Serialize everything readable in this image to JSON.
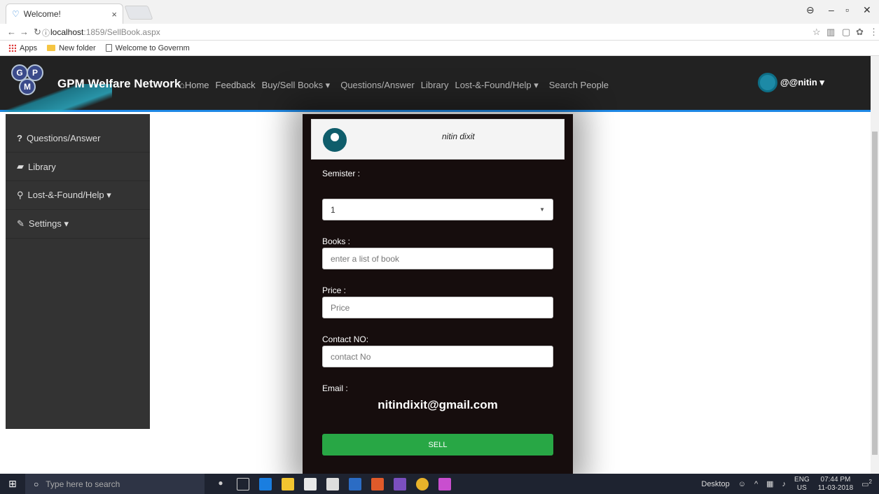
{
  "browser": {
    "tab_title": "Welcome!",
    "tab_close": "×",
    "url_host": "localhost",
    "url_path": ":1859/SellBook.aspx",
    "bookmarks": [
      "Apps",
      "New folder",
      "Welcome to Governm"
    ]
  },
  "navbar": {
    "brand": "GPM Welfare Network",
    "logo_letters": [
      "G",
      "P",
      "M"
    ],
    "links": [
      "Home",
      "Feedback",
      "Buy/Sell Books ▾",
      "Questions/Answer",
      "Library",
      "Lost-&-Found/Help ▾",
      "Search People"
    ],
    "user": "@@nitin ▾"
  },
  "sidebar": {
    "items": [
      {
        "icon": "?",
        "label": "Questions/Answer"
      },
      {
        "icon": "▰",
        "label": "Library"
      },
      {
        "icon": "⚲",
        "label": "Lost-&-Found/Help ▾"
      },
      {
        "icon": "✎",
        "label": "Settings ▾"
      }
    ]
  },
  "form": {
    "profile_name": "nitin dixit",
    "semester_label": "Semister :",
    "semester_value": "1",
    "books_label": "Books :",
    "books_placeholder": "enter a list of book",
    "price_label": "Price :",
    "price_placeholder": "Price",
    "contact_label": "Contact NO:",
    "contact_placeholder": "contact No",
    "email_label": "Email :",
    "email_value": "nitindixit@gmail.com",
    "sell_button": "SELL"
  },
  "taskbar": {
    "search_placeholder": "Type here to search",
    "desktop_label": "Desktop",
    "lang_top": "ENG",
    "lang_bottom": "US",
    "time": "07:44 PM",
    "date": "11-03-2018",
    "notifications": "2"
  },
  "colors": {
    "navbar_bg": "#222222",
    "accent": "#1e88e5",
    "sidebar_bg": "#333333",
    "card_bg": "#160d0d",
    "sell_btn": "#28a745"
  }
}
